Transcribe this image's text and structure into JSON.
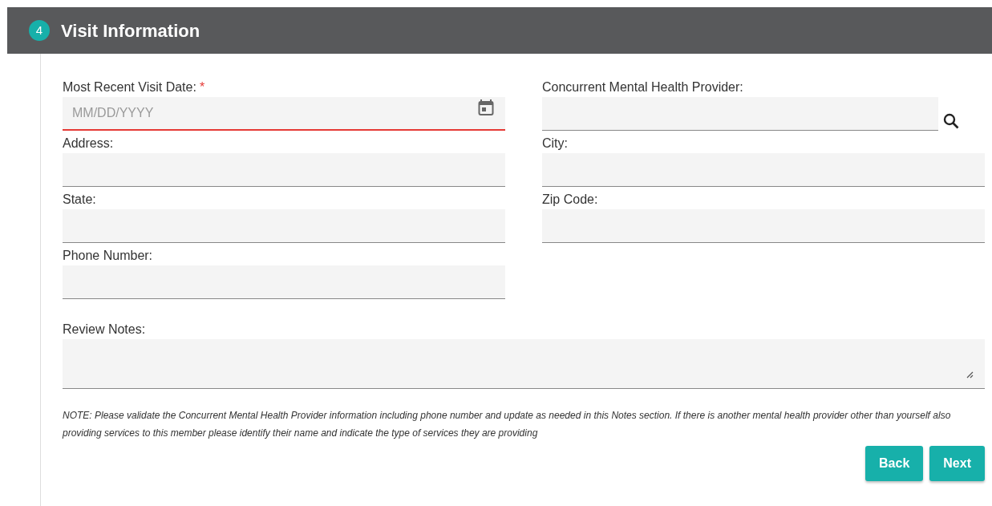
{
  "section": {
    "step": "4",
    "title": "Visit Information"
  },
  "fields": [
    {
      "label": "Most Recent Visit Date:",
      "kind": "date",
      "required_mark": "*",
      "invalid": true,
      "placeholder": "MM/DD/YYYY"
    },
    {
      "label": "Concurrent Mental Health Provider:",
      "kind": "lookup",
      "invalid": false
    },
    {
      "label": "Address:",
      "kind": "text",
      "invalid": false
    },
    {
      "label": "City:",
      "kind": "text",
      "invalid": false
    },
    {
      "label": "State:",
      "kind": "text",
      "invalid": false
    },
    {
      "label": "Zip Code:",
      "kind": "text",
      "invalid": false
    },
    {
      "label": "Phone Number:",
      "kind": "text",
      "invalid": false
    }
  ],
  "notes": {
    "label": "Review Notes:",
    "note": "NOTE: Please validate the Concurrent Mental Health Provider information including phone number and update as needed in this Notes section. If there is another mental health provider other than yourself also providing services to this member please identify their name and indicate the type of services they are providing"
  },
  "buttons": [
    "Back",
    "Next"
  ]
}
